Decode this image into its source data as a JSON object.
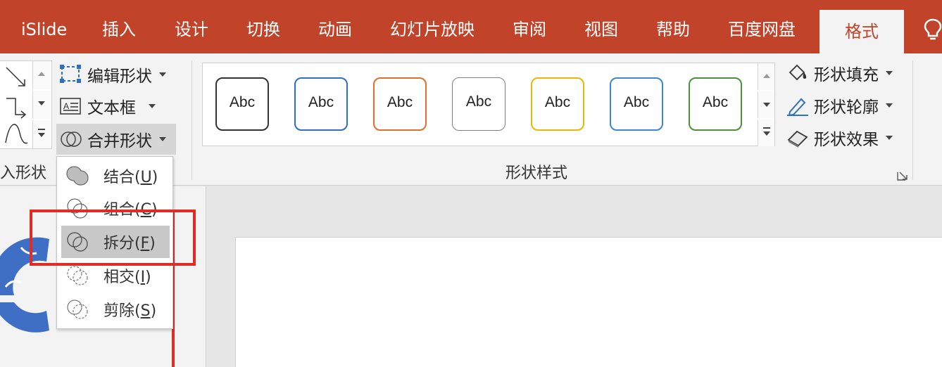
{
  "tabs": [
    {
      "label": "iSlide",
      "active": false
    },
    {
      "label": "插入",
      "active": false
    },
    {
      "label": "设计",
      "active": false
    },
    {
      "label": "切换",
      "active": false
    },
    {
      "label": "动画",
      "active": false
    },
    {
      "label": "幻灯片放映",
      "active": false
    },
    {
      "label": "审阅",
      "active": false
    },
    {
      "label": "视图",
      "active": false
    },
    {
      "label": "帮助",
      "active": false
    },
    {
      "label": "百度网盘",
      "active": false
    },
    {
      "label": "格式",
      "active": true
    }
  ],
  "insert_shapes": {
    "group_label": "入形状",
    "edit_shape": "编辑形状",
    "text_box": "文本框",
    "merge_shapes": "合并形状"
  },
  "shape_styles": {
    "group_label": "形状样式",
    "presets": [
      {
        "text": "Abc",
        "color": "#222222"
      },
      {
        "text": "Abc",
        "color": "#2e6fbf"
      },
      {
        "text": "Abc",
        "color": "#e0702d"
      },
      {
        "text": "Abc",
        "color": "#7f7f7f"
      },
      {
        "text": "Abc",
        "color": "#e7b70a"
      },
      {
        "text": "Abc",
        "color": "#3f86d0"
      },
      {
        "text": "Abc",
        "color": "#4e8f3a"
      }
    ],
    "shape_fill": "形状填充",
    "shape_outline": "形状轮廓",
    "shape_effects": "形状效果"
  },
  "merge_menu": {
    "items": [
      {
        "label": "结合(",
        "key": "U",
        "close": ")"
      },
      {
        "label": "组合(",
        "key": "C",
        "close": ")"
      },
      {
        "label": "拆分(",
        "key": "F",
        "close": ")"
      },
      {
        "label": "相交(",
        "key": "I",
        "close": ")"
      },
      {
        "label": "剪除(",
        "key": "S",
        "close": ")"
      }
    ]
  },
  "colors": {
    "accent": "#c0432a",
    "highlight_box": "#e12c25",
    "thumb_graphic": "#3f6fc4"
  }
}
